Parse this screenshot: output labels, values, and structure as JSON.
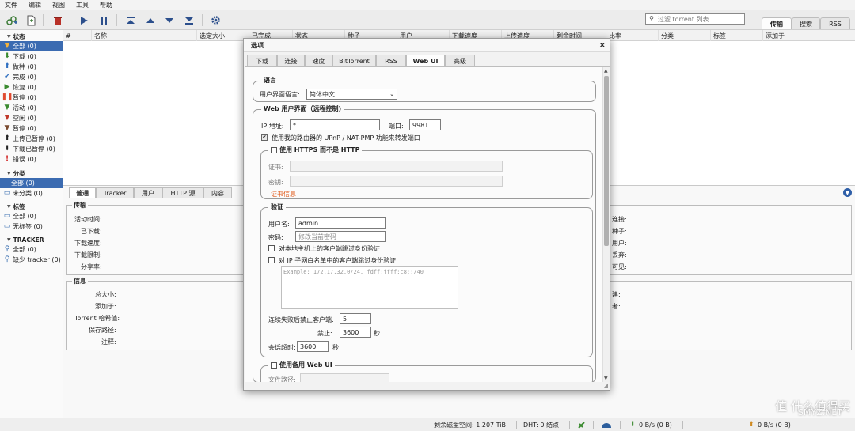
{
  "menu": [
    "文件",
    "编辑",
    "视图",
    "工具",
    "帮助"
  ],
  "toolbar": {
    "search_placeholder": "过滤 torrent 列表...",
    "tabs": [
      "传输",
      "搜索",
      "RSS"
    ]
  },
  "sidebar": {
    "status_header": "状态",
    "status_items": [
      "全部 (0)",
      "下载 (0)",
      "做种 (0)",
      "完成 (0)",
      "恢复 (0)",
      "暂停 (0)",
      "活动 (0)",
      "空闲 (0)",
      "暂停 (0)",
      "上传已暂停 (0)",
      "下载已暂停 (0)",
      "错误 (0)"
    ],
    "category_header": "分类",
    "category_items": [
      "全部 (0)",
      "未分类 (0)"
    ],
    "tags_header": "标签",
    "tags_items": [
      "全部 (0)",
      "无标签 (0)"
    ],
    "tracker_header": "TRACKER",
    "tracker_items": [
      "全部 (0)",
      "缺少 tracker (0)"
    ]
  },
  "table": {
    "columns": [
      "#",
      "名称",
      "选定大小",
      "已完成",
      "状态",
      "种子",
      "用户",
      "下载速度",
      "上传速度",
      "剩余时间",
      "比率",
      "分类",
      "标签",
      "添加于"
    ]
  },
  "props": {
    "tabs": [
      "普通",
      "Tracker",
      "用户",
      "HTTP 源",
      "内容"
    ],
    "transfer_legend": "传输",
    "transfer_labels": [
      "活动时间:",
      "已下载:",
      "下载速度:",
      "下载限制:",
      "分享率:"
    ],
    "transfer_right": [
      "连接:",
      "种子:",
      "用户:",
      "丢弃:",
      "可见:"
    ],
    "info_legend": "信息",
    "info_labels": [
      "总大小:",
      "添加于:",
      "Torrent 哈希值:",
      "保存路径:",
      "注释:"
    ],
    "info_right": [
      "建:",
      "者:"
    ]
  },
  "status": {
    "disk_free": "剩余磁盘空间: 1.207 TiB",
    "dht": "DHT: 0 结点",
    "down_speed": "0 B/s (0 B)",
    "up_speed": "0 B/s (0 B)"
  },
  "watermark": "值 什么值得买",
  "watermark2": "SMYZ.NET",
  "dialog": {
    "title": "选项",
    "tabs": [
      "下载",
      "连接",
      "速度",
      "BitTorrent",
      "RSS",
      "Web UI",
      "高级"
    ],
    "lang_legend": "语言",
    "lang_label": "用户界面语言:",
    "lang_value": "简体中文",
    "webui_legend": "Web 用户界面（远程控制)",
    "ip_label": "IP 地址:",
    "ip_value": "*",
    "port_label": "端口:",
    "port_value": "9981",
    "upnp_label": "使用我的路由器的 UPnP / NAT-PMP 功能来转发端口",
    "https_legend": "使用 HTTPS 而不是 HTTP",
    "cert_label": "证书:",
    "key_label": "密钥:",
    "cert_info": "证书信息",
    "auth_legend": "验证",
    "user_label": "用户名:",
    "user_value": "admin",
    "pass_label": "密码:",
    "pass_placeholder": "修改当前密码",
    "bypass_local": "对本地主机上的客户端跳过身份验证",
    "bypass_whitelist": "对 IP 子网白名单中的客户端跳过身份验证",
    "whitelist_placeholder": "Example: 172.17.32.0/24, fdff:ffff:c8::/40",
    "ban_label": "连续失败后禁止客户端:",
    "ban_value": "5",
    "ban_time_label": "禁止:",
    "ban_time_value": "3600",
    "sec_unit": "秒",
    "session_label": "会话超时:",
    "session_value": "3600",
    "alt_legend": "使用备用 Web UI",
    "file_path_label": "文件路径:"
  }
}
